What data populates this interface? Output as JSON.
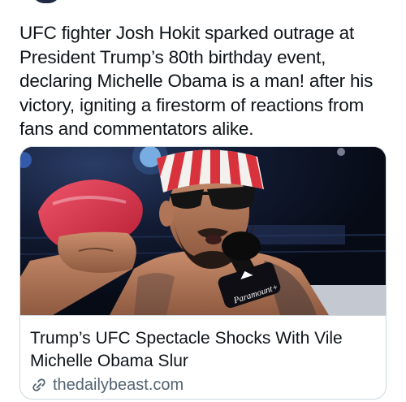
{
  "post": {
    "text": "UFC fighter Josh Hokit sparked outrage at President Trump’s 80th birthday event, declaring Michelle Obama is a man! after his victory, igniting a firestorm of reactions from fans and commentators alike."
  },
  "card": {
    "title": "Trump’s UFC Spectacle Shocks With Vile Michelle Obama Slur",
    "source": "thedailybeast.com",
    "image": {
      "mic_brand": "Paramount+"
    }
  },
  "icons": {
    "link": "link-icon"
  },
  "colors": {
    "text": "#0f1419",
    "secondary": "#536471",
    "border": "#cfd9de"
  }
}
